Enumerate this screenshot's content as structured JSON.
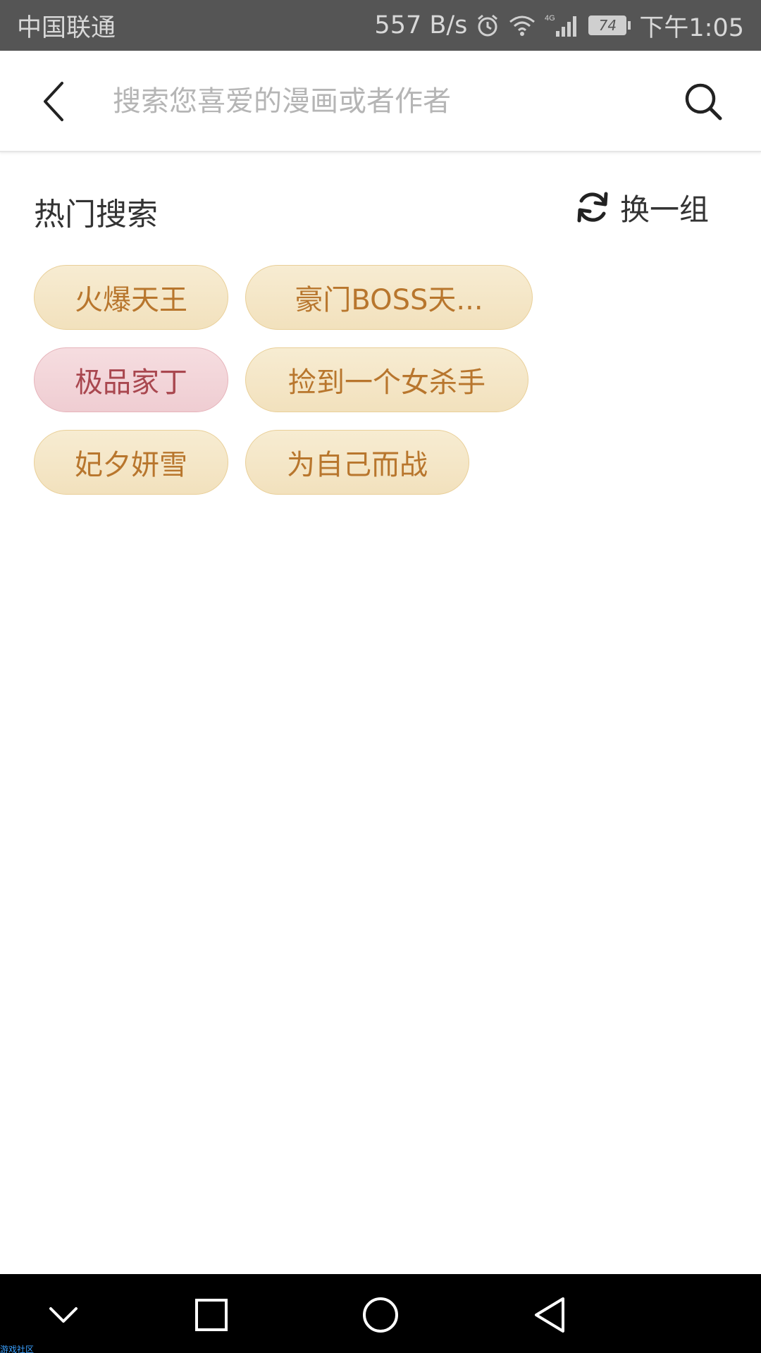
{
  "status_bar": {
    "carrier": "中国联通",
    "net_speed": "557 B/s",
    "network_type": "4G",
    "battery": "74",
    "time": "下午1:05"
  },
  "search": {
    "placeholder": "搜索您喜爱的漫画或者作者",
    "value": ""
  },
  "hot": {
    "title": "热门搜索",
    "refresh_label": "换一组",
    "tags": [
      {
        "label": "火爆天王",
        "style": "beige"
      },
      {
        "label": "豪门BOSS天...",
        "style": "beige"
      },
      {
        "label": "极品家丁",
        "style": "pink"
      },
      {
        "label": "捡到一个女杀手",
        "style": "beige"
      },
      {
        "label": "妃夕妍雪",
        "style": "beige"
      },
      {
        "label": "为自己而战",
        "style": "beige"
      }
    ]
  },
  "colors": {
    "tag_text": "#b8762d",
    "tag_bg": "#f4e6c8",
    "tag_pink_text": "#a9474f",
    "tag_pink_bg": "#f2d3d7"
  },
  "watermark": "游戏社区"
}
